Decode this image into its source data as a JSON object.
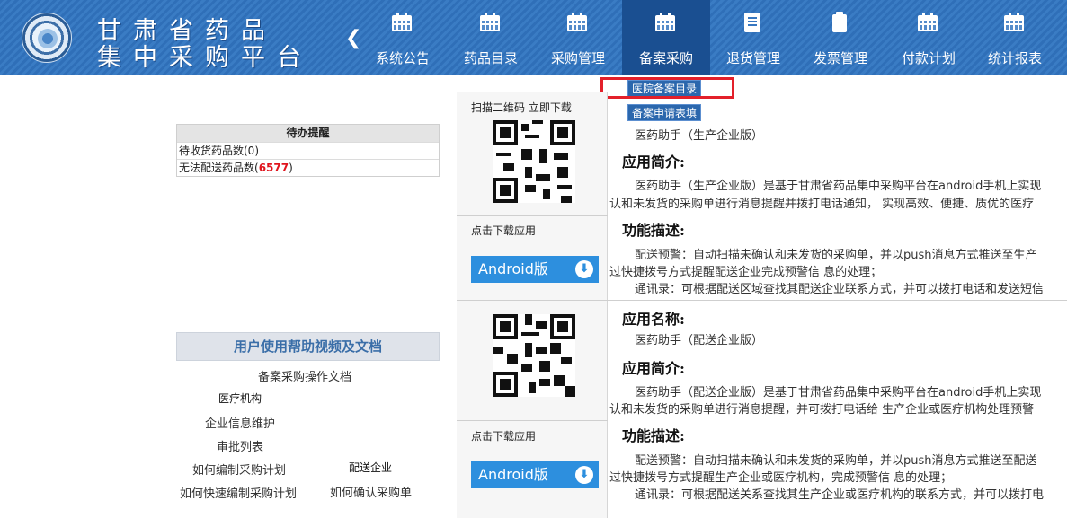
{
  "header": {
    "title_line1": "甘肃省药品",
    "title_line2": "集中采购平台",
    "collapse_glyph": "❮",
    "nav": [
      {
        "label": "系统公告",
        "icon": "calendar-icon"
      },
      {
        "label": "药品目录",
        "icon": "calendar-icon"
      },
      {
        "label": "采购管理",
        "icon": "calendar-icon"
      },
      {
        "label": "备案采购",
        "icon": "calendar-icon",
        "active": true
      },
      {
        "label": "退货管理",
        "icon": "document-icon"
      },
      {
        "label": "发票管理",
        "icon": "clipboard-icon"
      },
      {
        "label": "付款计划",
        "icon": "calendar-icon"
      },
      {
        "label": "统计报表",
        "icon": "calendar-icon"
      }
    ],
    "dropdown": [
      "医院备案目录",
      "备案申请表填写"
    ]
  },
  "pending": {
    "title": "待办提醒",
    "row1_label": "待收货药品数(0)",
    "row2_label": "无法配送药品数(",
    "row2_count": "6577",
    "row2_suffix": ")"
  },
  "help": {
    "title": "用户使用帮助视频及文档",
    "doc_link": "备案采购操作文档",
    "org_label": "医疗机构",
    "org_links": [
      "企业信息维护",
      "审批列表",
      "如何编制采购计划",
      "如何快速编制采购计划"
    ],
    "dist_label": "配送企业",
    "dist_links": [
      "如何确认采购单"
    ]
  },
  "apps": {
    "scan_label": "扫描二维码 立即下载",
    "download_label": "点击下载应用",
    "android_label": "Android版",
    "download_glyph": "⬇",
    "app1": {
      "name": "医药助手（生产企业版）",
      "intro_title": "应用简介:",
      "intro_1": "医药助手（生产企业版）是基于甘肃省药品集中采购平台在android手机上实现",
      "intro_2": "认和未发货的采购单进行消息提醒并拨打电话通知， 实现高效、便捷、质优的医疗",
      "feature_title": "功能描述:",
      "feature_1": "配送预警：自动扫描未确认和未发货的采购单，并以push消息方式推送至生产",
      "feature_2": "过快捷拨号方式提醒配送企业完成预警信 息的处理；",
      "feature_3": "通讯录：可根据配送区域查找其配送企业联系方式，并可以拨打电话和发送短信"
    },
    "app2": {
      "name_title": "应用名称:",
      "name": "医药助手（配送企业版）",
      "intro_title": "应用简介:",
      "intro_1": "医药助手（配送企业版）是基于甘肃省药品集中采购平台在android手机上实现",
      "intro_2": "认和未发货的采购单进行消息提醒，并可拨打电话给 生产企业或医疗机构处理预警",
      "feature_title": "功能描述:",
      "feature_1": "配送预警：自动扫描未确认和未发货的采购单，并以push消息方式推送至配送",
      "feature_2": "过快捷拨号方式提醒生产企业或医疗机构，完成预警信 息的处理；",
      "feature_3": "通讯录：可根据配送关系查找其生产企业或医疗机构的联系方式，并可以拨打电"
    }
  }
}
